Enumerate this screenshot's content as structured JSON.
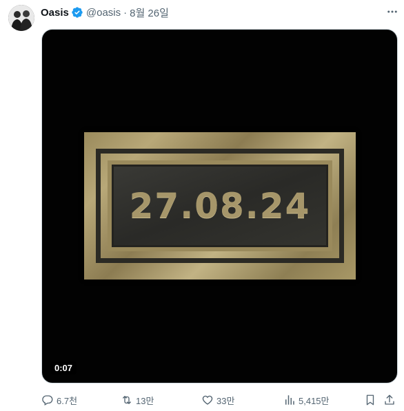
{
  "author": {
    "name": "Oasis",
    "handle": "@oasis",
    "separator": "·",
    "date": "8월 26일",
    "verified": true
  },
  "media": {
    "image_text": "27.08.24",
    "timestamp": "0:07"
  },
  "actions": {
    "replies": "6.7천",
    "retweets": "13만",
    "likes": "33만",
    "views": "5,415만"
  },
  "colors": {
    "verified_badge": "#1d9bf0",
    "muted_text": "#536471",
    "plate_gold": "#a6966a",
    "media_bg": "#020202"
  },
  "icons": {
    "more": "more-icon",
    "reply": "reply-icon",
    "retweet": "retweet-icon",
    "like": "heart-icon",
    "views": "views-icon",
    "bookmark": "bookmark-icon",
    "share": "share-icon"
  }
}
